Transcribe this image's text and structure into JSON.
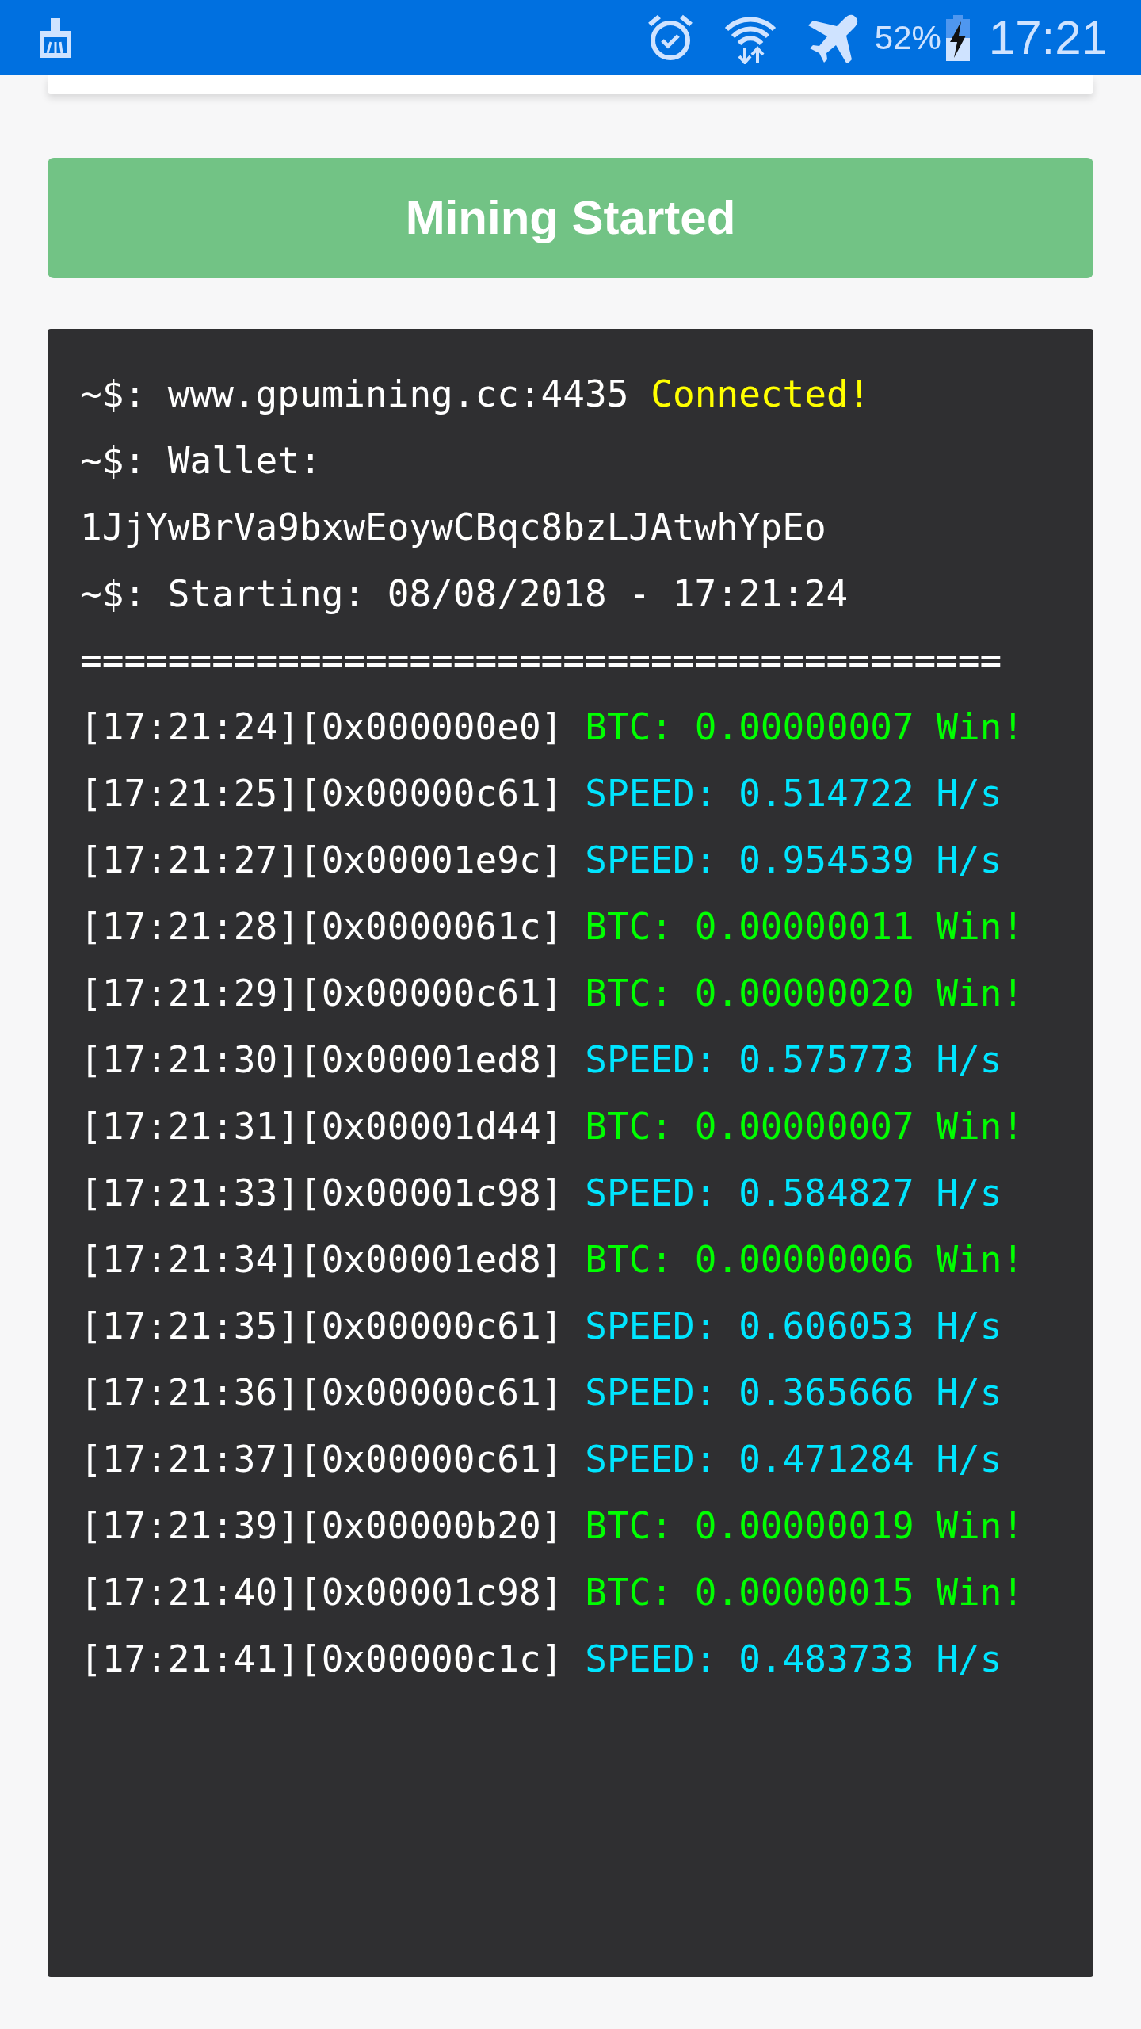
{
  "status_bar": {
    "battery_percent": "52%",
    "battery_charging": true,
    "time": "17:21"
  },
  "mining_button": {
    "label": "Mining Started"
  },
  "terminal": {
    "header": [
      {
        "prompt": "~$:",
        "text": "www.gpumining.cc:4435",
        "highlight": "Connected!"
      },
      {
        "prompt": "~$:",
        "text": "Wallet:"
      },
      {
        "text": "1JjYwBrVa9bxwEoywCBqc8bzLJAtwhYpEo"
      },
      {
        "prompt": "~$:",
        "text": "Starting: 08/08/2018 - 17:21:24"
      },
      {
        "text": "=========================================="
      }
    ],
    "log": [
      {
        "stamp": "[17:21:24][0x000000e0]",
        "kind": "btc",
        "message": "BTC: 0.00000007 Win!"
      },
      {
        "stamp": "[17:21:25][0x00000c61]",
        "kind": "speed",
        "message": "SPEED: 0.514722 H/s"
      },
      {
        "stamp": "[17:21:27][0x00001e9c]",
        "kind": "speed",
        "message": "SPEED: 0.954539 H/s"
      },
      {
        "stamp": "[17:21:28][0x0000061c]",
        "kind": "btc",
        "message": "BTC: 0.00000011 Win!"
      },
      {
        "stamp": "[17:21:29][0x00000c61]",
        "kind": "btc",
        "message": "BTC: 0.00000020 Win!"
      },
      {
        "stamp": "[17:21:30][0x00001ed8]",
        "kind": "speed",
        "message": "SPEED: 0.575773 H/s"
      },
      {
        "stamp": "[17:21:31][0x00001d44]",
        "kind": "btc",
        "message": "BTC: 0.00000007 Win!"
      },
      {
        "stamp": "[17:21:33][0x00001c98]",
        "kind": "speed",
        "message": "SPEED: 0.584827 H/s"
      },
      {
        "stamp": "[17:21:34][0x00001ed8]",
        "kind": "btc",
        "message": "BTC: 0.00000006 Win!"
      },
      {
        "stamp": "[17:21:35][0x00000c61]",
        "kind": "speed",
        "message": "SPEED: 0.606053 H/s"
      },
      {
        "stamp": "[17:21:36][0x00000c61]",
        "kind": "speed",
        "message": "SPEED: 0.365666 H/s"
      },
      {
        "stamp": "[17:21:37][0x00000c61]",
        "kind": "speed",
        "message": "SPEED: 0.471284 H/s"
      },
      {
        "stamp": "[17:21:39][0x00000b20]",
        "kind": "btc",
        "message": "BTC: 0.00000019 Win!"
      },
      {
        "stamp": "[17:21:40][0x00001c98]",
        "kind": "btc",
        "message": "BTC: 0.00000015 Win!"
      },
      {
        "stamp": "[17:21:41][0x00000c1c]",
        "kind": "speed",
        "message": "SPEED: 0.483733 H/s"
      }
    ]
  }
}
